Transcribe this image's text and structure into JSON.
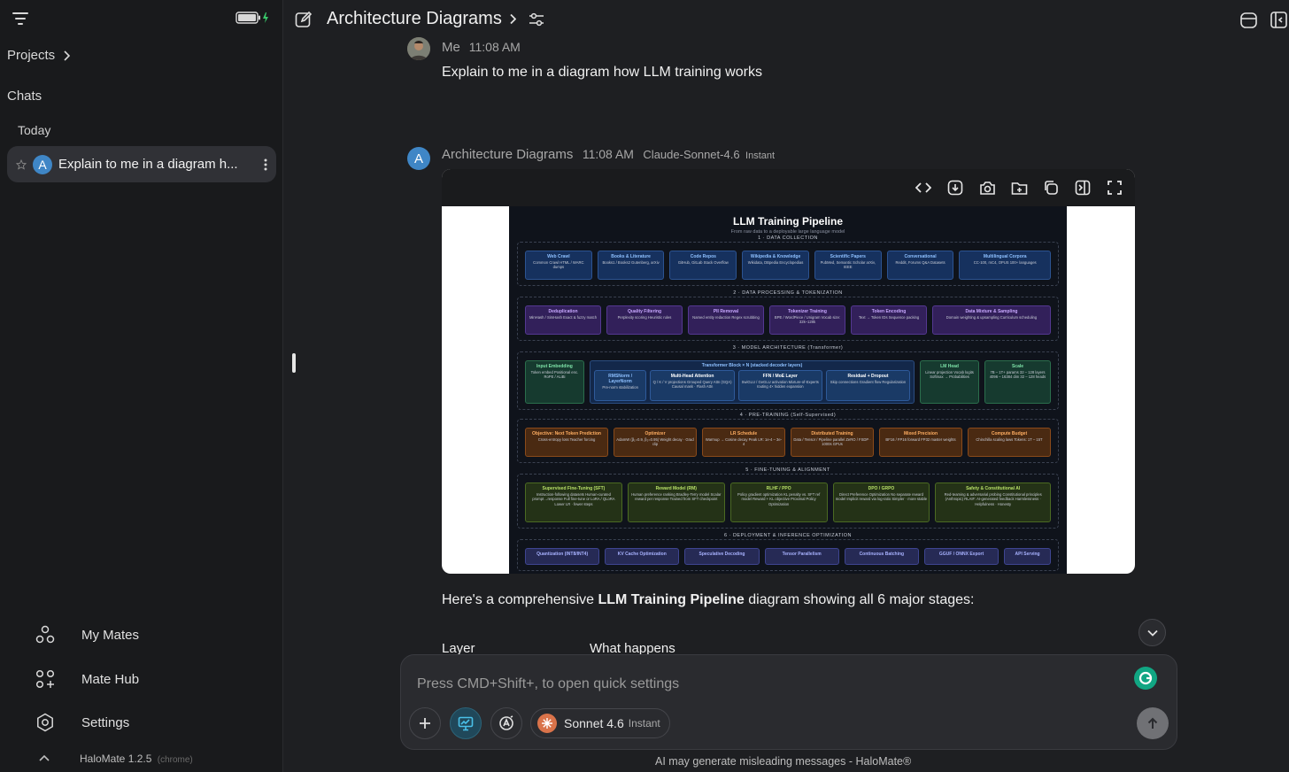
{
  "sidebar": {
    "projects": "Projects",
    "chats": "Chats",
    "today": "Today",
    "chat_item": "Explain to me in a diagram h...",
    "chat_avatar": "A",
    "nav": [
      {
        "label": "My Mates"
      },
      {
        "label": "Mate Hub"
      },
      {
        "label": "Settings"
      }
    ],
    "version": "HaloMate 1.2.5",
    "browser": "(chrome)"
  },
  "header": {
    "title": "Architecture Diagrams"
  },
  "messages": {
    "user": {
      "name": "Me",
      "time": "11:08 AM",
      "text": "Explain to me in a diagram how LLM training works"
    },
    "assistant": {
      "avatar": "A",
      "name": "Architecture Diagrams",
      "time": "11:08 AM",
      "model": "Claude-Sonnet-4.6",
      "model_tag": "Instant",
      "intro_pre": "Here's a comprehensive ",
      "intro_bold": "LLM Training Pipeline",
      "intro_post": " diagram showing all 6 major stages:",
      "table_headers": [
        "Layer",
        "What happens"
      ]
    }
  },
  "diagram": {
    "title": "LLM Training Pipeline",
    "subtitle": "From raw data to a deployable large language model",
    "stages": [
      {
        "label": "1 · DATA COLLECTION",
        "boxes": [
          {
            "t": "Web Crawl",
            "d": "Common Crawl HTML / WARC dumps"
          },
          {
            "t": "Books & Literature",
            "d": "Books1 / Books2 Gutenberg, arXiv"
          },
          {
            "t": "Code Repos",
            "d": "GitHub, GitLab Stack Overflow"
          },
          {
            "t": "Wikipedia & Knowledge",
            "d": "Wikidata, DBpedia Encyclopedias"
          },
          {
            "t": "Scientific Papers",
            "d": "PubMed, Semantic Scholar arXiv, IEEE"
          },
          {
            "t": "Conversational",
            "d": "Reddit, Forums Q&A Datasets"
          },
          {
            "t": "Multilingual Corpora",
            "d": "CC-100, mC4, OPUS 100+ languages"
          }
        ]
      },
      {
        "label": "2 · DATA PROCESSING & TOKENIZATION",
        "boxes": [
          {
            "t": "Deduplication",
            "d": "MinHash / SimHash Exact & fuzzy match"
          },
          {
            "t": "Quality Filtering",
            "d": "Perplexity scoring Heuristic rules"
          },
          {
            "t": "PII Removal",
            "d": "Named entity redaction Regex scrubbing"
          },
          {
            "t": "Tokenizer Training",
            "d": "BPE / WordPiece / Unigram Vocab size: 32k–128k"
          },
          {
            "t": "Token Encoding",
            "d": "Text → Token IDs Sequence packing"
          },
          {
            "t": "Data Mixture & Sampling",
            "d": "Domain weighting & upsampling Curriculum scheduling"
          }
        ]
      },
      {
        "label": "3 · MODEL ARCHITECTURE (Transformer)",
        "boxes": [
          {
            "t": "Input Embedding",
            "d": "Token embed Positional enc. RoPE / ALiBi"
          },
          {
            "t": "RMSNorm / LayerNorm",
            "d": "Pre-norm stabilization"
          },
          {
            "t": "Multi-Head Attention",
            "d": "Q / K / V projections Grouped Query Attn (GQA) Causal mask · Flash Attn"
          },
          {
            "t": "FFN / MoE Layer",
            "d": "SwiGLU / GeGLU activation Mixture-of-Experts routing 4× hidden expansion"
          },
          {
            "t": "Residual + Dropout",
            "d": "Skip connections Gradient flow Regularization"
          },
          {
            "t": "LM Head",
            "d": "Linear projection Vocab logits Softmax → Probabilities"
          },
          {
            "t": "Scale",
            "d": "7B – 1T+ params 32 – 128 layers 4096 – 16384 dim 32 – 128 heads"
          }
        ],
        "block_label": "Transformer Block × N (stacked decoder layers)"
      },
      {
        "label": "4 · PRE-TRAINING (Self-Supervised)",
        "boxes": [
          {
            "t": "Objective: Next Token Prediction",
            "d": "Cross-entropy loss Teacher forcing"
          },
          {
            "t": "Optimizer",
            "d": "AdamW (β₁=0.9, β₂=0.95) Weight decay · Grad clip"
          },
          {
            "t": "LR Schedule",
            "d": "Warmup → Cosine decay Peak LR: 1e-4 – 3e-4"
          },
          {
            "t": "Distributed Training",
            "d": "Data / Tensor / Pipeline parallel ZeRO / FSDP · 1000s GPUs"
          },
          {
            "t": "Mixed Precision",
            "d": "BF16 / FP16 forward FP32 master weights"
          },
          {
            "t": "Compute Budget",
            "d": "Chinchilla scaling laws Tokens: 1T – 15T"
          }
        ]
      },
      {
        "label": "5 · FINE-TUNING & ALIGNMENT",
        "boxes": [
          {
            "t": "Supervised Fine-Tuning (SFT)",
            "d": "Instruction-following datasets Human-curated prompt→response Full fine-tune or LoRA / QLoRA Lower LR · fewer steps"
          },
          {
            "t": "Reward Model (RM)",
            "d": "Human preference ranking Bradley-Terry model Scalar reward per response Trained from SFT checkpoint"
          },
          {
            "t": "RLHF / PPO",
            "d": "Policy gradient optimization KL penalty vs. SFT ref model Reward + KL objective Proximal Policy Optimization"
          },
          {
            "t": "DPO / GRPO",
            "d": "Direct Preference Optimization No separate reward model Implicit reward via log-ratio Simpler · more stable"
          },
          {
            "t": "Safety & Constitutional AI",
            "d": "Red-teaming & adversarial probing Constitutional principles (Anthropic) RLAIF: AI-generated feedback Harmlessness · Helpfulness · Honesty"
          }
        ]
      },
      {
        "label": "6 · DEPLOYMENT & INFERENCE OPTIMIZATION",
        "boxes": [
          {
            "t": "Quantization (INT8/INT4)",
            "d": ""
          },
          {
            "t": "KV Cache Optimization",
            "d": ""
          },
          {
            "t": "Speculative Decoding",
            "d": ""
          },
          {
            "t": "Tensor Parallelism",
            "d": ""
          },
          {
            "t": "Continuous Batching",
            "d": ""
          },
          {
            "t": "GGUF / ONNX Export",
            "d": ""
          },
          {
            "t": "API Serving",
            "d": ""
          }
        ]
      }
    ]
  },
  "input": {
    "placeholder": "Press CMD+Shift+, to open quick settings",
    "model": "Sonnet 4.6",
    "model_tag": "Instant"
  },
  "footer": {
    "disclaimer": "AI may generate misleading messages - HaloMate®"
  },
  "colors": {
    "accent": "#3f86c6",
    "sidebar_bg": "#191a1c",
    "main_bg": "#1e1f22",
    "active_chat": "#303136"
  }
}
